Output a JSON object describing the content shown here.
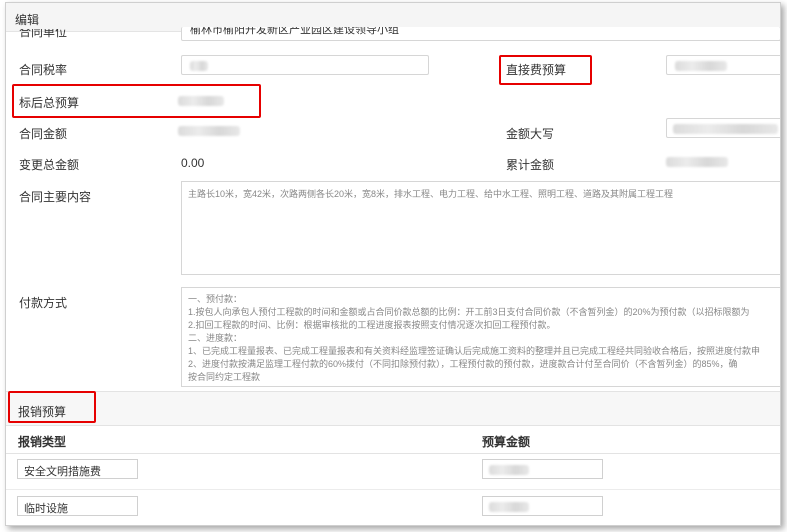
{
  "dialog": {
    "title": "编辑"
  },
  "form": {
    "top_partial_label": "合同单位",
    "top_partial_value": "榆林市榆阳开发新区产业园区建设领导小组",
    "tax_rate_label": "合同税率",
    "direct_budget_label": "直接费预算",
    "post_bid_budget_label": "标后总预算",
    "contract_amount_label": "合同金额",
    "amount_upper_label": "金额大写",
    "change_total_label": "变更总金额",
    "change_total_value": "0.00",
    "cumulative_label": "累计金额",
    "main_content_label": "合同主要内容",
    "main_content_value": "主路长10米，宽42米，次路两侧各长20米，宽8米，排水工程、电力工程、给中水工程、照明工程、道路及其附属工程工程",
    "payment_label": "付款方式",
    "payment_value": "一、预付款：\n1.按包人向承包人预付工程款的时间和金额或占合同价款总额的比例：开工前3日支付合同价款（不含暂列金）的20%为预付款（以招标限额为\n2.扣回工程款的时间、比例：根据审核批的工程进度报表按照支付情况逐次扣回工程预付款。\n二、进度款：\n1、已完成工程量报表、已完成工程量报表和有关资料经监理签证确认后完成施工资料的整理并且已完成工程经共同验收合格后，按照进度付款申\n2、进度付款按满足监理工程付款的60%拨付（不同扣除预付款），工程预付款的预付款，进度款合计付至合同价（不含暂列金）的85%，确\n按合同约定工程款"
  },
  "section": {
    "title": "报销预算"
  },
  "table": {
    "col_type": "报销类型",
    "col_amount": "预算金额",
    "rows": [
      {
        "type": "安全文明措施费"
      },
      {
        "type": "临时设施"
      }
    ]
  }
}
